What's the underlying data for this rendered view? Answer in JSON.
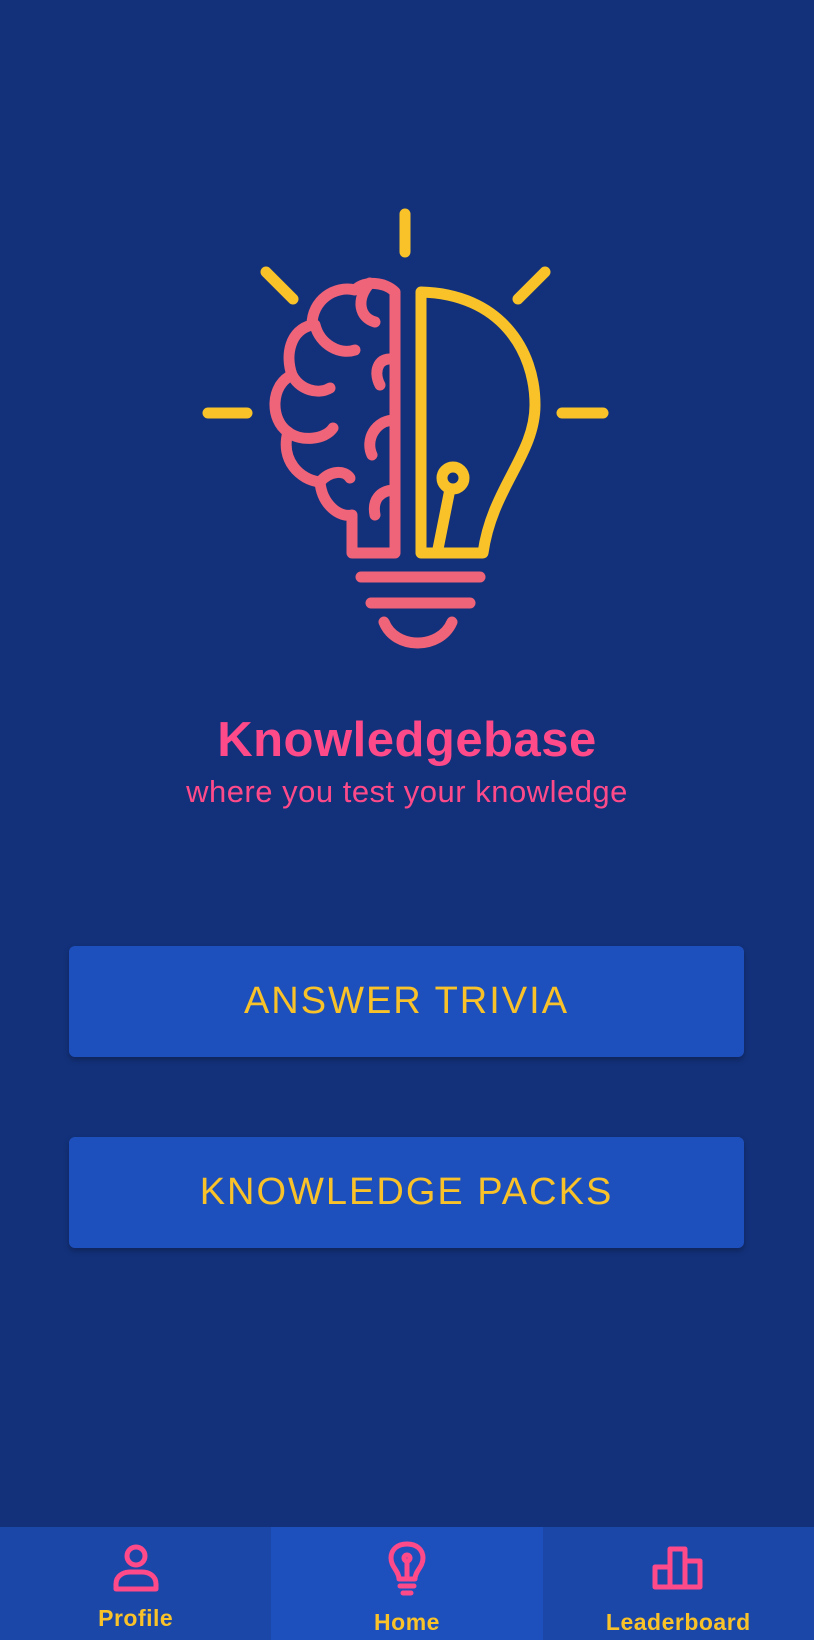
{
  "app": {
    "title": "Knowledgebase",
    "subtitle": "where you test your knowledge"
  },
  "actions": {
    "answer_trivia_label": "ANSWER TRIVIA",
    "knowledge_packs_label": "KNOWLEDGE PACKS"
  },
  "bottom_nav": {
    "items": [
      {
        "label": "Profile",
        "icon": "person-icon",
        "active": false
      },
      {
        "label": "Home",
        "icon": "lightbulb-icon",
        "active": true
      },
      {
        "label": "Leaderboard",
        "icon": "podium-icon",
        "active": false
      }
    ]
  },
  "colors": {
    "background": "#13317a",
    "button": "#1e50bd",
    "nav_background": "#1b47a8",
    "accent_pink": "#ff4a8a",
    "accent_yellow": "#f9c229",
    "logo_coral": "#ef6479"
  }
}
